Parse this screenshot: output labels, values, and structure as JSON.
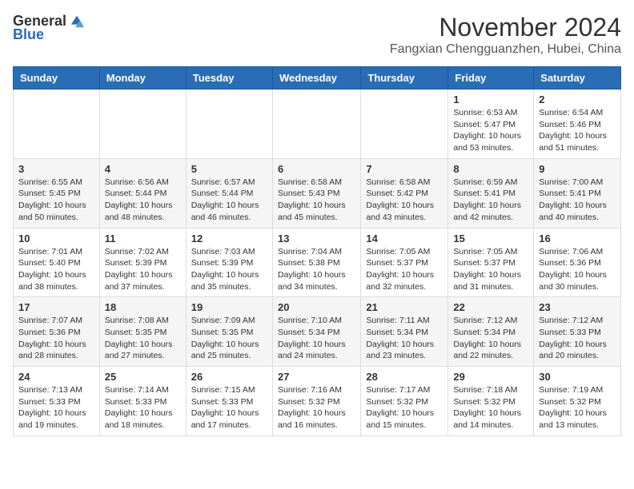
{
  "logo": {
    "general": "General",
    "blue": "Blue"
  },
  "header": {
    "month": "November 2024",
    "location": "Fangxian Chengguanzhen, Hubei, China"
  },
  "weekdays": [
    "Sunday",
    "Monday",
    "Tuesday",
    "Wednesday",
    "Thursday",
    "Friday",
    "Saturday"
  ],
  "weeks": [
    [
      {
        "day": "",
        "info": ""
      },
      {
        "day": "",
        "info": ""
      },
      {
        "day": "",
        "info": ""
      },
      {
        "day": "",
        "info": ""
      },
      {
        "day": "",
        "info": ""
      },
      {
        "day": "1",
        "info": "Sunrise: 6:53 AM\nSunset: 5:47 PM\nDaylight: 10 hours and 53 minutes."
      },
      {
        "day": "2",
        "info": "Sunrise: 6:54 AM\nSunset: 5:46 PM\nDaylight: 10 hours and 51 minutes."
      }
    ],
    [
      {
        "day": "3",
        "info": "Sunrise: 6:55 AM\nSunset: 5:45 PM\nDaylight: 10 hours and 50 minutes."
      },
      {
        "day": "4",
        "info": "Sunrise: 6:56 AM\nSunset: 5:44 PM\nDaylight: 10 hours and 48 minutes."
      },
      {
        "day": "5",
        "info": "Sunrise: 6:57 AM\nSunset: 5:44 PM\nDaylight: 10 hours and 46 minutes."
      },
      {
        "day": "6",
        "info": "Sunrise: 6:58 AM\nSunset: 5:43 PM\nDaylight: 10 hours and 45 minutes."
      },
      {
        "day": "7",
        "info": "Sunrise: 6:58 AM\nSunset: 5:42 PM\nDaylight: 10 hours and 43 minutes."
      },
      {
        "day": "8",
        "info": "Sunrise: 6:59 AM\nSunset: 5:41 PM\nDaylight: 10 hours and 42 minutes."
      },
      {
        "day": "9",
        "info": "Sunrise: 7:00 AM\nSunset: 5:41 PM\nDaylight: 10 hours and 40 minutes."
      }
    ],
    [
      {
        "day": "10",
        "info": "Sunrise: 7:01 AM\nSunset: 5:40 PM\nDaylight: 10 hours and 38 minutes."
      },
      {
        "day": "11",
        "info": "Sunrise: 7:02 AM\nSunset: 5:39 PM\nDaylight: 10 hours and 37 minutes."
      },
      {
        "day": "12",
        "info": "Sunrise: 7:03 AM\nSunset: 5:39 PM\nDaylight: 10 hours and 35 minutes."
      },
      {
        "day": "13",
        "info": "Sunrise: 7:04 AM\nSunset: 5:38 PM\nDaylight: 10 hours and 34 minutes."
      },
      {
        "day": "14",
        "info": "Sunrise: 7:05 AM\nSunset: 5:37 PM\nDaylight: 10 hours and 32 minutes."
      },
      {
        "day": "15",
        "info": "Sunrise: 7:05 AM\nSunset: 5:37 PM\nDaylight: 10 hours and 31 minutes."
      },
      {
        "day": "16",
        "info": "Sunrise: 7:06 AM\nSunset: 5:36 PM\nDaylight: 10 hours and 30 minutes."
      }
    ],
    [
      {
        "day": "17",
        "info": "Sunrise: 7:07 AM\nSunset: 5:36 PM\nDaylight: 10 hours and 28 minutes."
      },
      {
        "day": "18",
        "info": "Sunrise: 7:08 AM\nSunset: 5:35 PM\nDaylight: 10 hours and 27 minutes."
      },
      {
        "day": "19",
        "info": "Sunrise: 7:09 AM\nSunset: 5:35 PM\nDaylight: 10 hours and 25 minutes."
      },
      {
        "day": "20",
        "info": "Sunrise: 7:10 AM\nSunset: 5:34 PM\nDaylight: 10 hours and 24 minutes."
      },
      {
        "day": "21",
        "info": "Sunrise: 7:11 AM\nSunset: 5:34 PM\nDaylight: 10 hours and 23 minutes."
      },
      {
        "day": "22",
        "info": "Sunrise: 7:12 AM\nSunset: 5:34 PM\nDaylight: 10 hours and 22 minutes."
      },
      {
        "day": "23",
        "info": "Sunrise: 7:12 AM\nSunset: 5:33 PM\nDaylight: 10 hours and 20 minutes."
      }
    ],
    [
      {
        "day": "24",
        "info": "Sunrise: 7:13 AM\nSunset: 5:33 PM\nDaylight: 10 hours and 19 minutes."
      },
      {
        "day": "25",
        "info": "Sunrise: 7:14 AM\nSunset: 5:33 PM\nDaylight: 10 hours and 18 minutes."
      },
      {
        "day": "26",
        "info": "Sunrise: 7:15 AM\nSunset: 5:33 PM\nDaylight: 10 hours and 17 minutes."
      },
      {
        "day": "27",
        "info": "Sunrise: 7:16 AM\nSunset: 5:32 PM\nDaylight: 10 hours and 16 minutes."
      },
      {
        "day": "28",
        "info": "Sunrise: 7:17 AM\nSunset: 5:32 PM\nDaylight: 10 hours and 15 minutes."
      },
      {
        "day": "29",
        "info": "Sunrise: 7:18 AM\nSunset: 5:32 PM\nDaylight: 10 hours and 14 minutes."
      },
      {
        "day": "30",
        "info": "Sunrise: 7:19 AM\nSunset: 5:32 PM\nDaylight: 10 hours and 13 minutes."
      }
    ]
  ]
}
